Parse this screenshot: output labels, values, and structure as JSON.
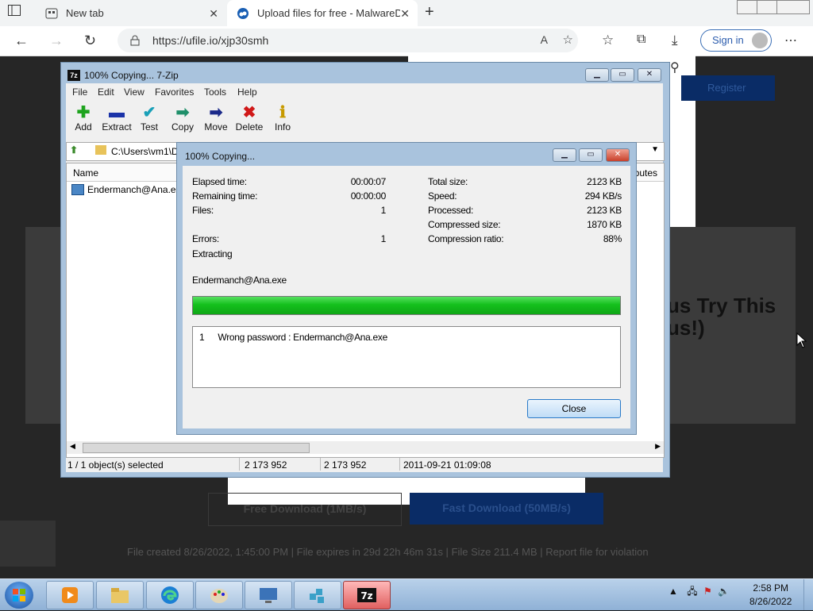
{
  "browser": {
    "tabs": [
      {
        "title": "New tab"
      },
      {
        "title": "Upload files for free - MalwareDa"
      }
    ],
    "url": "https://ufile.io/xjp30smh",
    "signin_label": "Sign in"
  },
  "page": {
    "headline_line1": "us Try This",
    "headline_line2": "us!)",
    "register_label": "Register",
    "free_download_label": "Free Download (1MB/s)",
    "fast_download_label": "Fast Download (50MB/s)",
    "file_info": "File created  8/26/2022, 1:45:00 PM   |   File expires in  29d 22h 46m 31s   |   File Size  211.4 MB   |   Report file for violation"
  },
  "zip_window": {
    "title": "100% Copying... 7-Zip",
    "menu": [
      "File",
      "Edit",
      "View",
      "Favorites",
      "Tools",
      "Help"
    ],
    "toolbar": [
      {
        "label": "Add",
        "icon": "add-icon",
        "glyph": "✚",
        "color": "#1ea31e"
      },
      {
        "label": "Extract",
        "icon": "extract-icon",
        "glyph": "▬",
        "color": "#1b33a8"
      },
      {
        "label": "Test",
        "icon": "test-icon",
        "glyph": "✔",
        "color": "#1aa0b8"
      },
      {
        "label": "Copy",
        "icon": "copy-icon",
        "glyph": "➡",
        "color": "#1f8f6a"
      },
      {
        "label": "Move",
        "icon": "move-icon",
        "glyph": "➡",
        "color": "#1b2a8a"
      },
      {
        "label": "Delete",
        "icon": "delete-icon",
        "glyph": "✖",
        "color": "#d01818"
      },
      {
        "label": "Info",
        "icon": "info-icon",
        "glyph": "ℹ",
        "color": "#c79a00"
      }
    ],
    "path": "C:\\Users\\vm1\\D",
    "columns": {
      "name": "Name",
      "attributes": "ributes"
    },
    "files": [
      {
        "name": "Endermanch@Ana.exe"
      }
    ],
    "status": {
      "selected": "1 / 1 object(s) selected",
      "size": "2 173 952",
      "packed": "2 173 952",
      "modified": "2011-09-21 01:09:08"
    }
  },
  "progress_dialog": {
    "title": "100% Copying...",
    "elapsed_label": "Elapsed time:",
    "elapsed_value": "00:00:07",
    "remaining_label": "Remaining time:",
    "remaining_value": "00:00:00",
    "files_label": "Files:",
    "files_value": "1",
    "errors_label": "Errors:",
    "errors_value": "1",
    "total_label": "Total size:",
    "total_value": "2123 KB",
    "speed_label": "Speed:",
    "speed_value": "294 KB/s",
    "processed_label": "Processed:",
    "processed_value": "2123 KB",
    "compressed_label": "Compressed size:",
    "compressed_value": "1870 KB",
    "ratio_label": "Compression ratio:",
    "ratio_value": "88%",
    "operation": "Extracting",
    "current_file": "Endermanch@Ana.exe",
    "progress_fraction": 1.0,
    "message_index": "1",
    "message_text": "Wrong password : Endermanch@Ana.exe",
    "close_label": "Close"
  },
  "taskbar": {
    "apps": [
      {
        "icon": "media-player-icon"
      },
      {
        "icon": "file-explorer-icon"
      },
      {
        "icon": "edge-icon"
      },
      {
        "icon": "paint-icon"
      },
      {
        "icon": "remote-desktop-icon"
      },
      {
        "icon": "registry-icon"
      },
      {
        "icon": "7zip-icon"
      }
    ],
    "time": "2:58 PM",
    "date": "8/26/2022"
  }
}
